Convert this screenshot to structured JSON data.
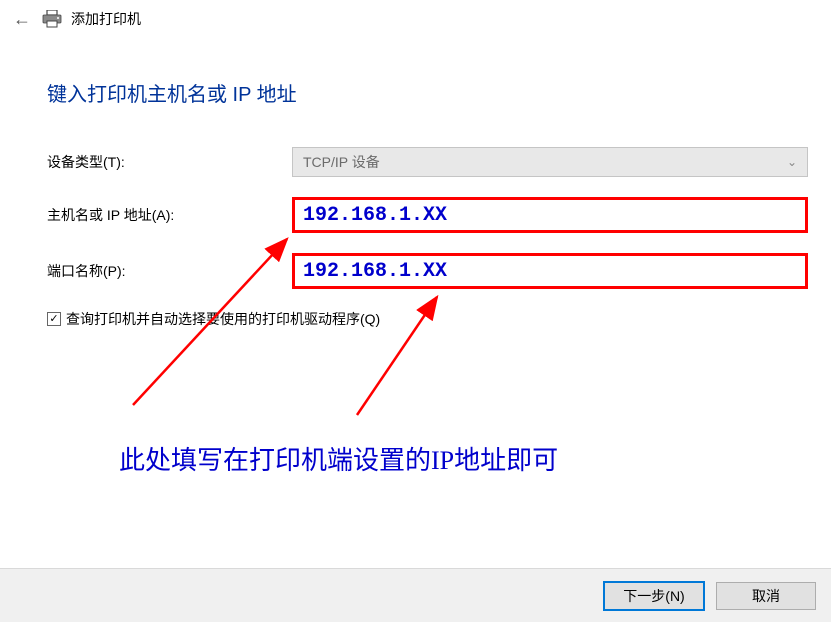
{
  "header": {
    "title": "添加打印机"
  },
  "page_heading": "键入打印机主机名或 IP 地址",
  "form": {
    "device_type": {
      "label": "设备类型(T):",
      "value": "TCP/IP 设备"
    },
    "host": {
      "label": "主机名或 IP 地址(A):",
      "value": "192.168.1.XX"
    },
    "port": {
      "label": "端口名称(P):",
      "value": "192.168.1.XX"
    },
    "checkbox_label": "查询打印机并自动选择要使用的打印机驱动程序(Q)"
  },
  "annotation": "此处填写在打印机端设置的IP地址即可",
  "buttons": {
    "next": "下一步(N)",
    "cancel": "取消"
  }
}
